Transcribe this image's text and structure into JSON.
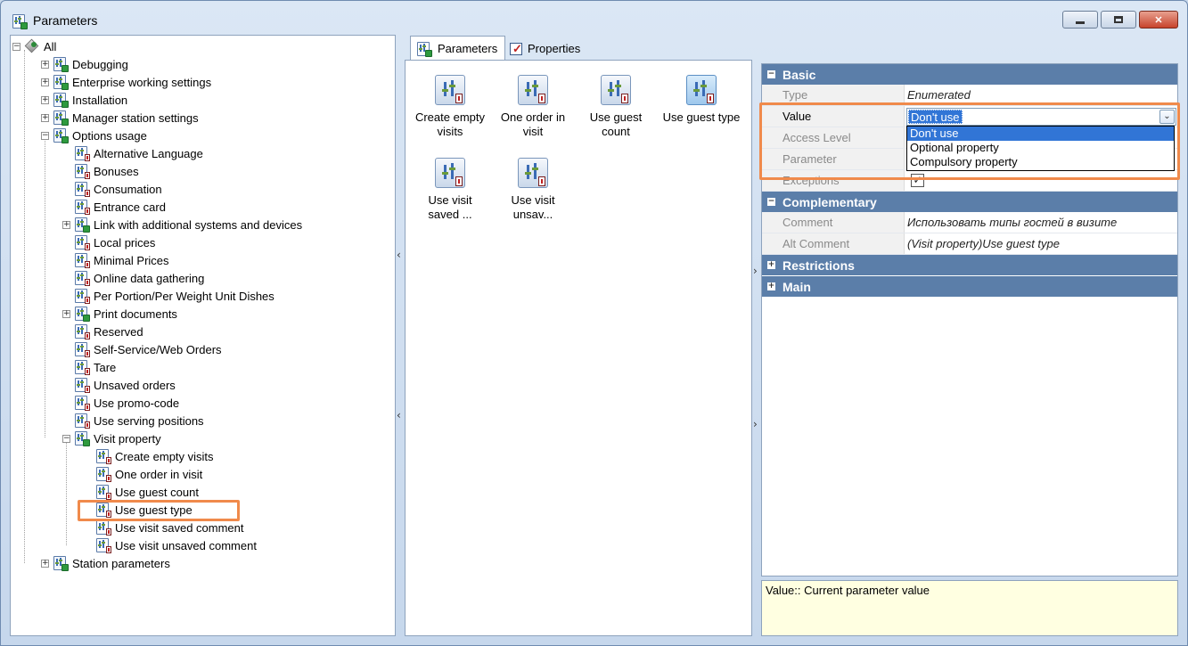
{
  "window": {
    "title": "Parameters"
  },
  "tree": {
    "root": "All",
    "items": [
      {
        "label": "Debugging"
      },
      {
        "label": "Enterprise working settings"
      },
      {
        "label": "Installation"
      },
      {
        "label": "Manager station settings"
      },
      {
        "label": "Options usage"
      },
      {
        "label": "Alternative Language"
      },
      {
        "label": "Bonuses"
      },
      {
        "label": "Consumation"
      },
      {
        "label": "Entrance card"
      },
      {
        "label": "Link with additional systems and devices"
      },
      {
        "label": "Local prices"
      },
      {
        "label": "Minimal Prices"
      },
      {
        "label": "Online data gathering"
      },
      {
        "label": "Per Portion/Per Weight Unit Dishes"
      },
      {
        "label": "Print documents"
      },
      {
        "label": "Reserved"
      },
      {
        "label": "Self-Service/Web Orders"
      },
      {
        "label": "Tare"
      },
      {
        "label": "Unsaved orders"
      },
      {
        "label": "Use promo-code"
      },
      {
        "label": "Use serving positions"
      },
      {
        "label": "Visit property"
      },
      {
        "label": "Create empty visits"
      },
      {
        "label": "One order in visit"
      },
      {
        "label": "Use guest count"
      },
      {
        "label": "Use guest type"
      },
      {
        "label": "Use visit saved comment"
      },
      {
        "label": "Use visit unsaved comment"
      },
      {
        "label": "Station parameters"
      }
    ]
  },
  "tabs": [
    {
      "label": "Parameters"
    },
    {
      "label": "Properties"
    }
  ],
  "items_view": [
    {
      "line1": "Create empty",
      "line2": "visits"
    },
    {
      "line1": "One order in",
      "line2": "visit"
    },
    {
      "line1": "Use guest",
      "line2": "count"
    },
    {
      "line1": "Use guest type",
      "line2": ""
    },
    {
      "line1": "Use visit",
      "line2": "saved ..."
    },
    {
      "line1": "Use visit",
      "line2": "unsav..."
    }
  ],
  "properties": {
    "basic": {
      "title": "Basic",
      "type_label": "Type",
      "type_value": "Enumerated",
      "value_label": "Value",
      "value_value": "Don't use",
      "access_label": "Access Level",
      "parameter_label": "Parameter",
      "exceptions_label": "Exceptions",
      "exceptions_check": "✓"
    },
    "dropdown_options": [
      "Don't use",
      "Optional property",
      "Compulsory property"
    ],
    "complementary": {
      "title": "Complementary",
      "comment_label": "Comment",
      "comment_value": "Использовать типы гостей в визите",
      "alt_comment_label": "Alt Comment",
      "alt_comment_value": "(Visit property)Use guest type"
    },
    "restrictions_title": "Restrictions",
    "main_title": "Main"
  },
  "description": "Value:: Current parameter value",
  "colors": {
    "category_bg": "#5b7ea9",
    "selection": "#3175d6",
    "highlight_box": "#f08a4b",
    "description_bg": "#ffffe1"
  }
}
